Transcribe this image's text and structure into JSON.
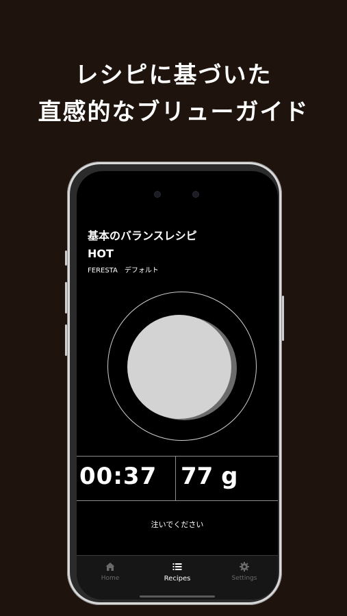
{
  "headline": {
    "line1": "レシピに基づいた",
    "line2": "直感的なブリューガイド"
  },
  "recipe": {
    "title_line1": "基本のバランスレシピ",
    "title_line2": "HOT",
    "subtitle": "FERESTA　デフォルト"
  },
  "brew": {
    "time": "00:37",
    "weight": "77 g",
    "instruction": "注いでください"
  },
  "tabs": [
    {
      "label": "Home",
      "icon": "home-icon"
    },
    {
      "label": "Recipes",
      "icon": "list-icon"
    },
    {
      "label": "Settings",
      "icon": "gear-icon"
    }
  ],
  "colors": {
    "background": "#1e140d",
    "screen": "#000000",
    "disc": "#d3d3d3",
    "tab_inactive": "#6a6a6a"
  }
}
